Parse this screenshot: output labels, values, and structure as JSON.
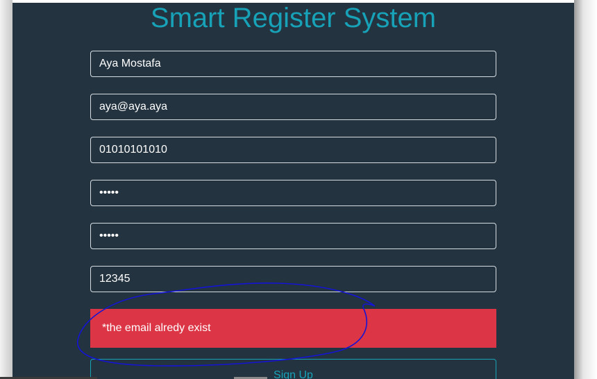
{
  "app": {
    "title": "Smart Register System"
  },
  "form": {
    "name_value": "Aya Mostafa",
    "email_value": "aya@aya.aya",
    "phone_value": "01010101010",
    "password_value": "12345",
    "confirm_password_value": "12345",
    "code_value": "12345",
    "error_message": "*the email alredy exist",
    "signup_label": "Sign Up"
  },
  "colors": {
    "panel_bg": "#233340",
    "accent": "#17a2b8",
    "error": "#dc3545",
    "annotation_stroke": "#1414d4"
  }
}
